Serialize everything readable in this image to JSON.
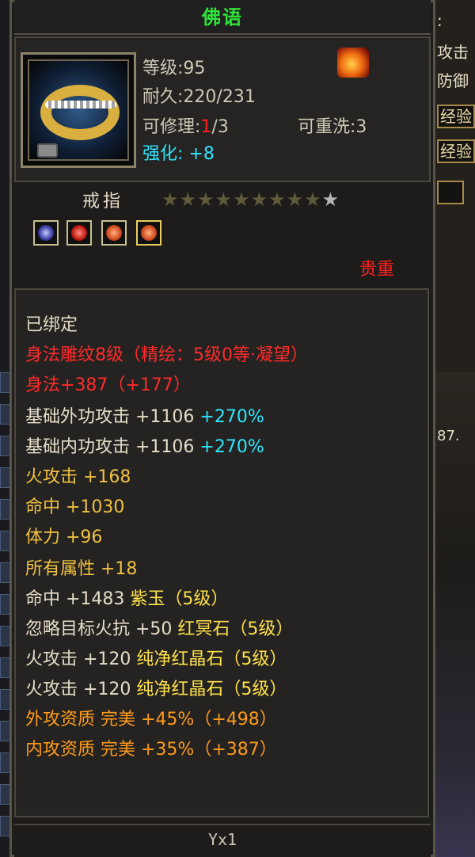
{
  "tooltip": {
    "title": "佛语",
    "level": "等级:95",
    "durability": {
      "prefix": "耐久:",
      "value": "220/231"
    },
    "repairable": {
      "prefix": "可修理:",
      "used": "1",
      "total": "/3"
    },
    "rewash": "可重洗:3",
    "enhance": {
      "label": "强化:",
      "value": "+8"
    },
    "item_type": "戒指",
    "stars": {
      "filled": 9,
      "total": 10
    },
    "rarity": "贵重",
    "footer": "Yx1"
  },
  "attributes": {
    "bound": "已绑定",
    "engrave": "身法雕纹8级（精绘：5级0等·凝望）",
    "shenfa": "身法+387（+177）",
    "base_outer": {
      "text": "基础外功攻击 +1106 ",
      "bonus": "+270%"
    },
    "base_inner": {
      "text": "基础内功攻击 +1106 ",
      "bonus": "+270%"
    },
    "fire_attack": "火攻击 +168",
    "hit": "命中 +1030",
    "stamina": "体力 +96",
    "all_attr": "所有属性 +18",
    "gem1": {
      "text": "命中 +1483 ",
      "gem": "紫玉（5级）"
    },
    "gem2": {
      "text": "忽略目标火抗 +50 ",
      "gem": "红冥石（5级）"
    },
    "gem3": {
      "text": "火攻击 +120 ",
      "gem": "纯净红晶石（5级）"
    },
    "gem4": {
      "text": "火攻击 +120 ",
      "gem": "纯净红晶石（5级）"
    },
    "aptitude_outer": "外攻资质  完美 +45%（+498）",
    "aptitude_inner": "内攻资质  完美 +35%（+387）"
  },
  "background": {
    "right_text_1": "攻击",
    "right_text_2": "防御",
    "btn_1": "经验",
    "btn_2": "经验",
    "right_text_3": "87.",
    "colon": ":"
  },
  "colors": {
    "title_green": "#2fe33a",
    "rarity_red": "#ff2020",
    "cyan": "#2ee6ff",
    "yellow": "#f0c040",
    "orange": "#ff9a1a"
  },
  "icons": [
    "ring-item-icon",
    "lock-icon",
    "set-bonus-icon",
    "star-icon",
    "gem-socket-icon"
  ]
}
